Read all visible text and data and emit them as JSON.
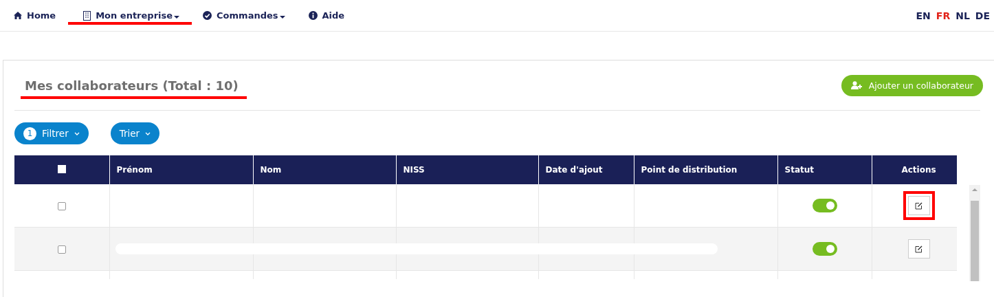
{
  "nav": {
    "items": [
      {
        "label": "Home",
        "dropdown": false,
        "annotated": false
      },
      {
        "label": "Mon entreprise",
        "dropdown": true,
        "annotated": true
      },
      {
        "label": "Commandes",
        "dropdown": true,
        "annotated": false
      },
      {
        "label": "Aide",
        "dropdown": false,
        "annotated": false
      }
    ],
    "languages": [
      {
        "label": "EN",
        "selected": false
      },
      {
        "label": "FR",
        "selected": true
      },
      {
        "label": "NL",
        "selected": false
      },
      {
        "label": "DE",
        "selected": false
      }
    ]
  },
  "panel": {
    "title": "Mes collaborateurs (Total : 10)",
    "add_button": "Ajouter un collaborateur",
    "filter_button": {
      "label": "Filtrer",
      "badge": "1"
    },
    "sort_button": {
      "label": "Trier"
    }
  },
  "table": {
    "columns": [
      "Prénom",
      "Nom",
      "NISS",
      "Date d'ajout",
      "Point de distribution",
      "Statut",
      "Actions"
    ],
    "select_all_checked": false,
    "rows": [
      {
        "checked": false,
        "on": true,
        "redacted": false,
        "annotated": true
      },
      {
        "checked": false,
        "on": true,
        "redacted": true,
        "annotated": false
      }
    ]
  }
}
